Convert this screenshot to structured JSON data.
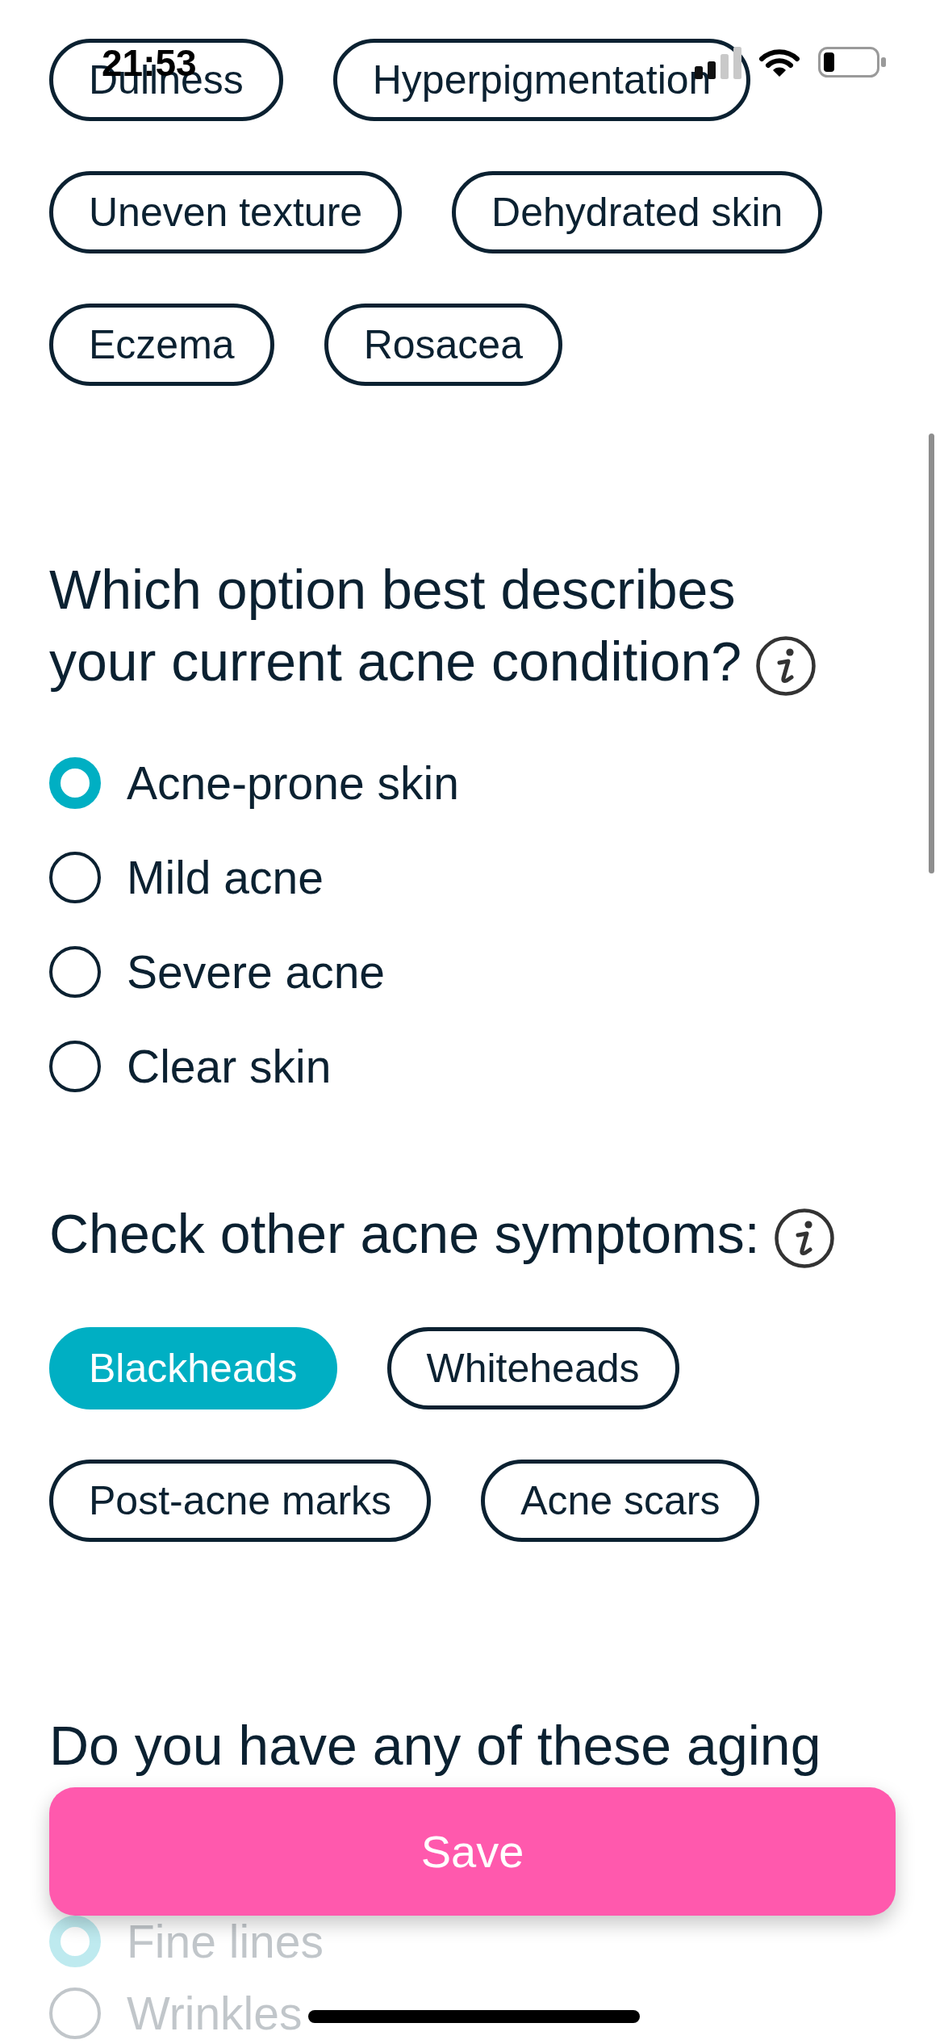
{
  "status_bar": {
    "time": "21:53"
  },
  "sections": [
    {
      "kind": "chips",
      "chips": [
        {
          "label": "Dullness",
          "selected": false
        },
        {
          "label": "Hyperpigmentation",
          "selected": false
        },
        {
          "label": "Uneven texture",
          "selected": false
        },
        {
          "label": "Dehydrated skin",
          "selected": false
        },
        {
          "label": "Eczema",
          "selected": false
        },
        {
          "label": "Rosacea",
          "selected": false
        }
      ]
    },
    {
      "kind": "radio",
      "title": "Which option best describes your current acne condition?",
      "info": true,
      "options": [
        {
          "label": "Acne-prone skin",
          "selected": true
        },
        {
          "label": "Mild acne",
          "selected": false
        },
        {
          "label": "Severe acne",
          "selected": false
        },
        {
          "label": "Clear skin",
          "selected": false
        }
      ]
    },
    {
      "kind": "chips",
      "title": "Check other acne symptoms:",
      "info": true,
      "chips": [
        {
          "label": "Blackheads",
          "selected": true
        },
        {
          "label": "Whiteheads",
          "selected": false
        },
        {
          "label": "Post-acne marks",
          "selected": false
        },
        {
          "label": "Acne scars",
          "selected": false
        }
      ]
    },
    {
      "kind": "radio",
      "title": "Do you have any of these aging",
      "options": [
        {
          "label": "Fine lines",
          "selected": true
        },
        {
          "label": "Wrinkles",
          "selected": false
        }
      ]
    }
  ],
  "save_button": {
    "label": "Save"
  }
}
